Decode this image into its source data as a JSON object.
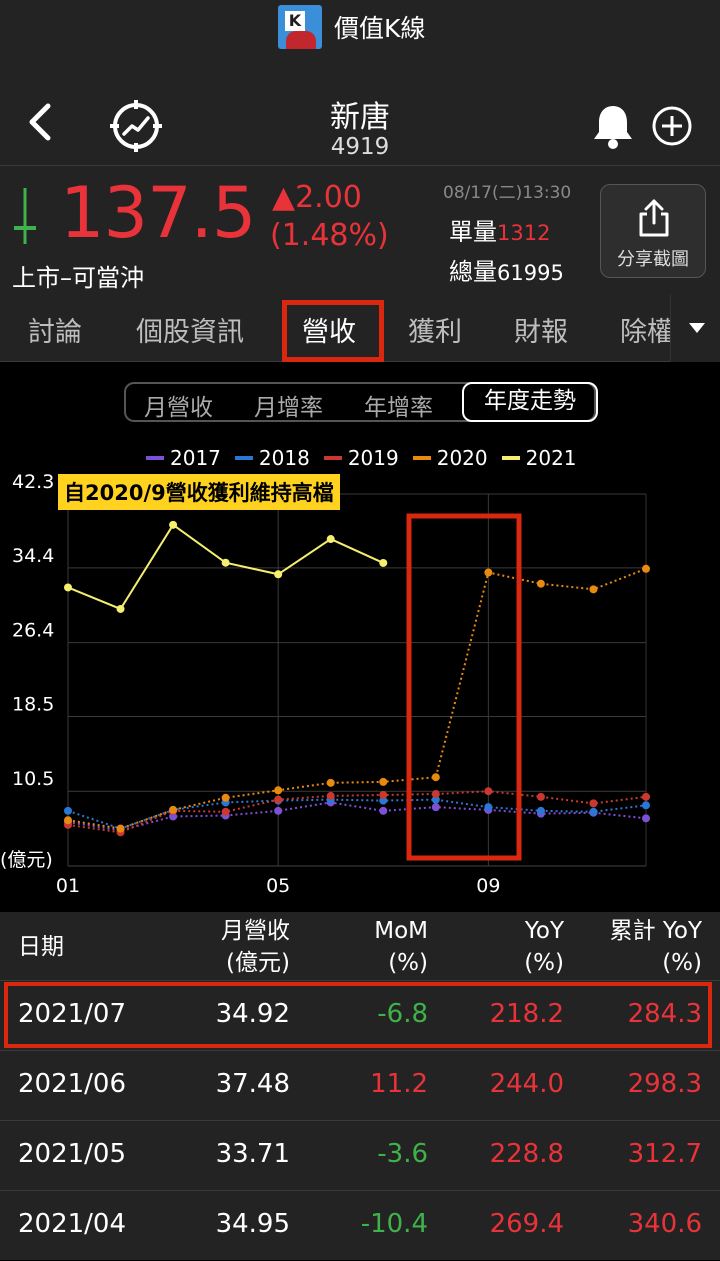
{
  "app": {
    "title": "價值K線"
  },
  "stock": {
    "name": "新唐",
    "code": "4919"
  },
  "quote": {
    "price": "137.5",
    "change": "▲2.00",
    "change_pct": "(1.48%)",
    "market": "上市–可當沖",
    "time": "08/17(二)13:30",
    "unit_vol_label": "單量",
    "unit_vol": "1312",
    "total_vol_label": "總量",
    "total_vol": "61995",
    "share_label": "分享截圖"
  },
  "tabs": [
    "討論",
    "個股資訊",
    "營收",
    "獲利",
    "財報",
    "除權"
  ],
  "active_tab": "營收",
  "segments": [
    "月營收",
    "月增率",
    "年增率",
    "年度走勢"
  ],
  "active_segment": "年度走勢",
  "colors": {
    "accent_red": "#e8333a",
    "accent_green": "#3fb24b",
    "highlight": "#d9280f",
    "annotation_bg": "#ffd21f"
  },
  "chart_data": {
    "type": "line",
    "annotation": "自2020/9營收獲利維持高檔",
    "y_unit": "(億元)",
    "yticks": [
      "42.3",
      "34.4",
      "26.4",
      "18.5",
      "10.5"
    ],
    "ylim": [
      2.5,
      42.3
    ],
    "xticks": [
      {
        "m": 1,
        "label": "01"
      },
      {
        "m": 5,
        "label": "05"
      },
      {
        "m": 9,
        "label": "09"
      }
    ],
    "x": [
      1,
      2,
      3,
      4,
      5,
      6,
      7,
      8,
      9,
      10,
      11,
      12
    ],
    "series": [
      {
        "name": "2017",
        "color": "#7e50d6",
        "style": "dotted",
        "values": [
          7.2,
          6.3,
          7.8,
          7.9,
          8.4,
          9.3,
          8.4,
          8.8,
          8.5,
          8.1,
          8.2,
          7.6
        ]
      },
      {
        "name": "2018",
        "color": "#2a78d6",
        "style": "dotted",
        "values": [
          8.4,
          6.5,
          8.5,
          9.3,
          9.5,
          9.6,
          9.5,
          9.6,
          8.8,
          8.4,
          8.3,
          9.0
        ]
      },
      {
        "name": "2019",
        "color": "#c9392f",
        "style": "dotted",
        "values": [
          6.9,
          6.1,
          8.4,
          8.3,
          9.6,
          10.0,
          10.1,
          10.2,
          10.5,
          9.9,
          9.2,
          9.9
        ]
      },
      {
        "name": "2020",
        "color": "#e88a10",
        "style": "dotted",
        "values": [
          7.4,
          6.5,
          8.5,
          9.8,
          10.6,
          11.4,
          11.5,
          12.0,
          33.9,
          32.7,
          32.1,
          34.3
        ]
      },
      {
        "name": "2021",
        "color": "#f5ee6e",
        "style": "solid",
        "values": [
          32.3,
          30.0,
          39.0,
          34.95,
          33.71,
          37.48,
          34.92
        ]
      }
    ]
  },
  "table": {
    "headers": [
      {
        "l1": "日期",
        "l2": ""
      },
      {
        "l1": "月營收",
        "l2": "(億元)"
      },
      {
        "l1": "MoM",
        "l2": "(%)"
      },
      {
        "l1": "YoY",
        "l2": "(%)"
      },
      {
        "l1": "累計 YoY",
        "l2": "(%)"
      }
    ],
    "rows": [
      {
        "date": "2021/07",
        "rev": "34.92",
        "mom": "-6.8",
        "yoy": "218.2",
        "cyoy": "284.3"
      },
      {
        "date": "2021/06",
        "rev": "37.48",
        "mom": "11.2",
        "yoy": "244.0",
        "cyoy": "298.3"
      },
      {
        "date": "2021/05",
        "rev": "33.71",
        "mom": "-3.6",
        "yoy": "228.8",
        "cyoy": "312.7"
      },
      {
        "date": "2021/04",
        "rev": "34.95",
        "mom": "-10.4",
        "yoy": "269.4",
        "cyoy": "340.6"
      }
    ]
  }
}
